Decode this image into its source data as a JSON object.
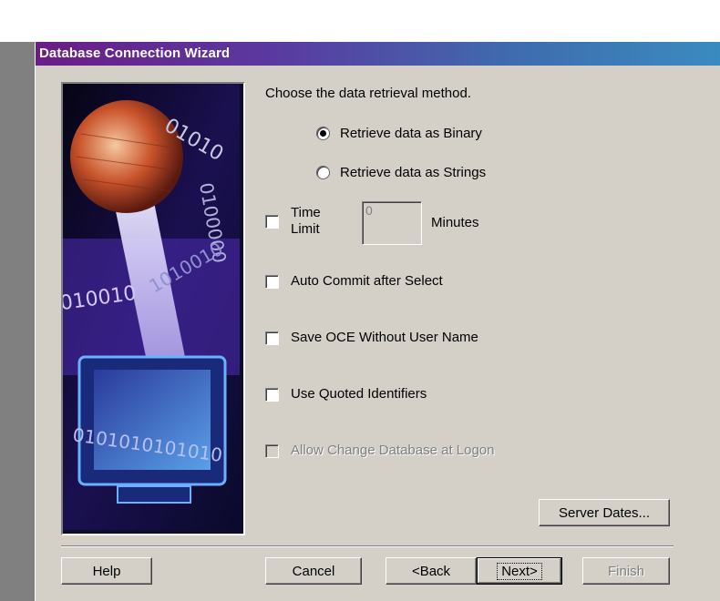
{
  "window": {
    "title": "Database Connection Wizard"
  },
  "method": {
    "prompt": "Choose the data retrieval method.",
    "options": [
      {
        "label": "Retrieve data as Binary",
        "selected": true
      },
      {
        "label": "Retrieve data as Strings",
        "selected": false
      }
    ]
  },
  "time_limit": {
    "label_line1": "Time",
    "label_line2": "Limit",
    "value": "0",
    "unit": "Minutes",
    "checked": false
  },
  "checkboxes": [
    {
      "label": "Auto Commit after Select",
      "checked": false,
      "enabled": true
    },
    {
      "label": "Save OCE Without User Name",
      "checked": false,
      "enabled": true
    },
    {
      "label": "Use Quoted Identifiers",
      "checked": false,
      "enabled": true
    },
    {
      "label": "Allow Change Database at Logon",
      "checked": false,
      "enabled": false
    }
  ],
  "buttons": {
    "server_dates": "Server Dates...",
    "help": "Help",
    "cancel": "Cancel",
    "back": "<Back",
    "next": "Next>",
    "finish": "Finish"
  },
  "illustration": {
    "binary_texts": [
      "01010",
      "0100000",
      "1010010",
      "010010",
      "0101010101010"
    ],
    "colors": {
      "sphere": "#c8522a",
      "beam": "#d8d0f0",
      "background": "#120c3a",
      "monitor": "#3a7bd0"
    }
  }
}
